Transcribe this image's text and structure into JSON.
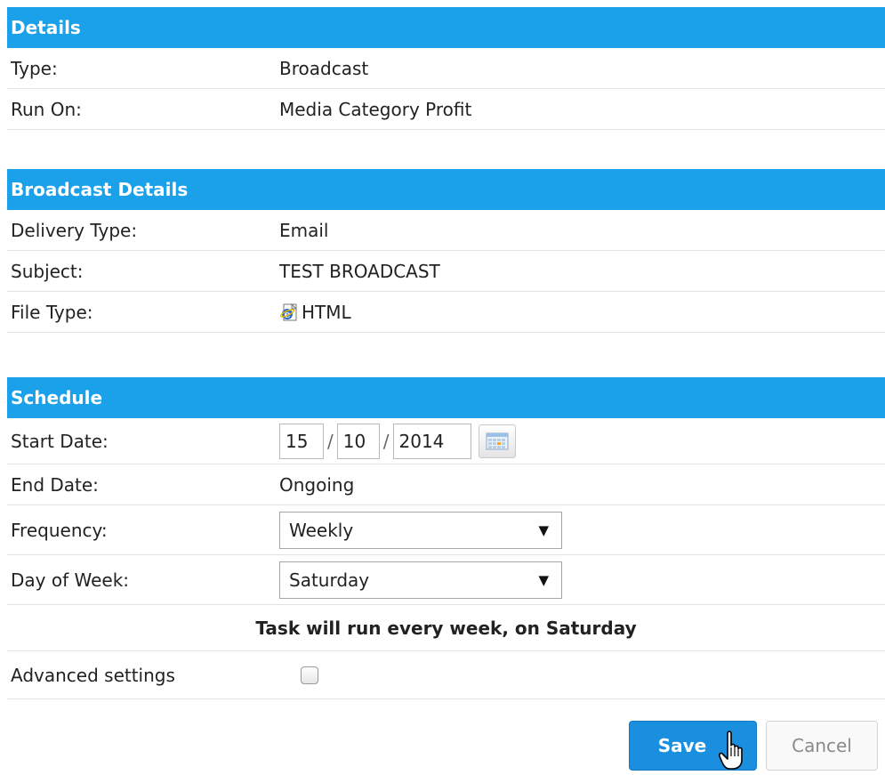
{
  "details": {
    "header": "Details",
    "rows": [
      {
        "label": "Type:",
        "value": "Broadcast"
      },
      {
        "label": "Run On:",
        "value": "Media Category Profit"
      }
    ]
  },
  "broadcast_details": {
    "header": "Broadcast Details",
    "delivery_type": {
      "label": "Delivery Type:",
      "value": "Email"
    },
    "subject": {
      "label": "Subject:",
      "value": "TEST BROADCAST"
    },
    "file_type": {
      "label": "File Type:",
      "value": "HTML",
      "icon": "ie-html-icon"
    }
  },
  "schedule": {
    "header": "Schedule",
    "start_date": {
      "label": "Start Date:",
      "day": "15",
      "month": "10",
      "year": "2014",
      "separator": "/"
    },
    "end_date": {
      "label": "End Date:",
      "value": "Ongoing"
    },
    "frequency": {
      "label": "Frequency:",
      "selected": "Weekly"
    },
    "day_of_week": {
      "label": "Day of Week:",
      "selected": "Saturday"
    },
    "summary": "Task will run every week, on Saturday",
    "advanced": {
      "label": "Advanced settings",
      "checked": false
    }
  },
  "buttons": {
    "save": "Save",
    "cancel": "Cancel"
  },
  "colors": {
    "header_bg": "#1aa1ea",
    "save_bg": "#1a8fe0",
    "row_border": "#e2e2e2"
  }
}
